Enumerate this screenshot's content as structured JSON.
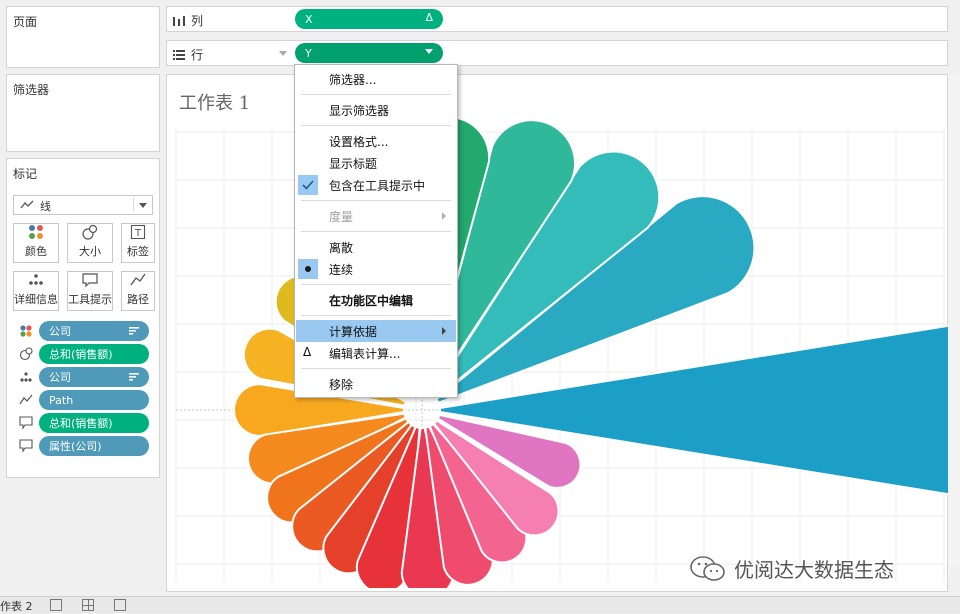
{
  "panels": {
    "pages": "页面",
    "filters": "筛选器",
    "marks": "标记"
  },
  "marks_card": {
    "mark_type": "线",
    "buttons": [
      "颜色",
      "大小",
      "标签",
      "详细信息",
      "工具提示",
      "路径"
    ],
    "fields": [
      {
        "label": "公司",
        "kind": "color",
        "pill": "blue"
      },
      {
        "label": "总和(销售额)",
        "kind": "size",
        "pill": "green"
      },
      {
        "label": "公司",
        "kind": "detail",
        "pill": "blue"
      },
      {
        "label": "Path",
        "kind": "path",
        "pill": "blue"
      },
      {
        "label": "总和(销售额)",
        "kind": "tooltip",
        "pill": "green"
      },
      {
        "label": "属性(公司)",
        "kind": "tooltip",
        "pill": "blue"
      }
    ]
  },
  "shelves": {
    "columns": {
      "label": "列",
      "pill": "X",
      "pill_icon": "Δ"
    },
    "rows": {
      "label": "行",
      "pill": "Y"
    }
  },
  "sheet": {
    "title": "工作表 1"
  },
  "context_menu": {
    "items": [
      "筛选器...",
      "显示筛选器",
      "设置格式...",
      "显示标题",
      "包含在工具提示中",
      "度量",
      "离散",
      "连续",
      "在功能区中编辑",
      "计算依据",
      "编辑表计算...",
      "移除"
    ]
  },
  "watermark": "优阅达大数据生态",
  "bottom_tab": "作表 2",
  "chart_data": {
    "type": "radial",
    "petals": [
      {
        "angle": 0,
        "length": 0.98,
        "color": "#1b9fc6"
      },
      {
        "angle": 30,
        "length": 0.6,
        "color": "#2aa9c3"
      },
      {
        "angle": 48,
        "length": 0.53,
        "color": "#34bcbb"
      },
      {
        "angle": 66,
        "length": 0.5,
        "color": "#2fb89a"
      },
      {
        "angle": 84,
        "length": 0.47,
        "color": "#23a86d"
      },
      {
        "angle": 110,
        "length": 0.32,
        "color": "#8fb02a"
      },
      {
        "angle": 122,
        "length": 0.31,
        "color": "#c4bf25"
      },
      {
        "angle": 138,
        "length": 0.3,
        "color": "#dfba1f"
      },
      {
        "angle": 160,
        "length": 0.3,
        "color": "#f5b222"
      },
      {
        "angle": 180,
        "length": 0.3,
        "color": "#f7a81f"
      },
      {
        "angle": 198,
        "length": 0.29,
        "color": "#f58b1e"
      },
      {
        "angle": 214,
        "length": 0.29,
        "color": "#f0741c"
      },
      {
        "angle": 228,
        "length": 0.29,
        "color": "#ea5a22"
      },
      {
        "angle": 242,
        "length": 0.29,
        "color": "#e4402a"
      },
      {
        "angle": 256,
        "length": 0.3,
        "color": "#e63238"
      },
      {
        "angle": 272,
        "length": 0.3,
        "color": "#ea3852"
      },
      {
        "angle": 287,
        "length": 0.29,
        "color": "#ef4c6d"
      },
      {
        "angle": 302,
        "length": 0.28,
        "color": "#f46490"
      },
      {
        "angle": 318,
        "length": 0.28,
        "color": "#f47fb0"
      },
      {
        "angle": 338,
        "length": 0.27,
        "color": "#e075c2"
      }
    ]
  }
}
